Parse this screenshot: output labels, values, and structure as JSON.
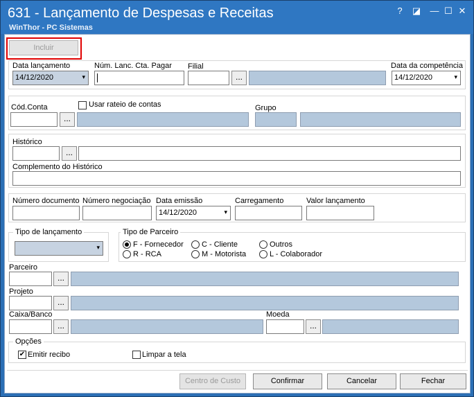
{
  "window": {
    "title": "631 - Lançamento de Despesas e Receitas",
    "subtitle": "WinThor - PC Sistemas",
    "help": "?",
    "restore": "◪",
    "minimize": "—",
    "maximize": "☐",
    "close": "✕"
  },
  "toolbar": {
    "incluir_label": "Incluir"
  },
  "header": {
    "data_lancamento_label": "Data lançamento",
    "data_lancamento_value": "14/12/2020",
    "num_lanc_label": "Núm. Lanc. Cta. Pagar",
    "num_lanc_value": "",
    "filial_label": "Filial",
    "data_competencia_label": "Data da competência",
    "data_competencia_value": "14/12/2020"
  },
  "conta": {
    "cod_conta_label": "Cód.Conta",
    "usar_rateio_label": "Usar rateio de contas",
    "grupo_label": "Grupo"
  },
  "historico": {
    "historico_label": "Histórico",
    "complemento_label": "Complemento do Histórico"
  },
  "documento": {
    "numero_documento_label": "Número documento",
    "numero_negociacao_label": "Número negociação",
    "data_emissao_label": "Data emissão",
    "data_emissao_value": "14/12/2020",
    "carregamento_label": "Carregamento",
    "valor_lancamento_label": "Valor lançamento"
  },
  "tipo_lancamento": {
    "label": "Tipo de lançamento",
    "value": ""
  },
  "tipo_parceiro": {
    "label": "Tipo de Parceiro",
    "options": [
      "F - Fornecedor",
      "C - Cliente",
      "Outros",
      "R - RCA",
      "M - Motorista",
      "L - Colaborador"
    ],
    "selected": "F - Fornecedor"
  },
  "parceiro": {
    "label": "Parceiro"
  },
  "projeto": {
    "label": "Projeto"
  },
  "caixa_banco": {
    "label": "Caixa/Banco"
  },
  "moeda": {
    "label": "Moeda"
  },
  "opcoes": {
    "label": "Opções",
    "emitir_recibo_label": "Emitir recibo",
    "emitir_recibo_checked": true,
    "limpar_tela_label": "Limpar a tela",
    "limpar_tela_checked": false
  },
  "footer": {
    "centro_custo_label": "Centro de Custo",
    "confirmar_label": "Confirmar",
    "cancelar_label": "Cancelar",
    "fechar_label": "Fechar"
  },
  "dots": "...",
  "chevron": "▾",
  "check_mark": "✔",
  "colors": {
    "title_bar": "#2f77c2",
    "highlight": "#e00000",
    "readonly_field": "#b4c8dc"
  }
}
